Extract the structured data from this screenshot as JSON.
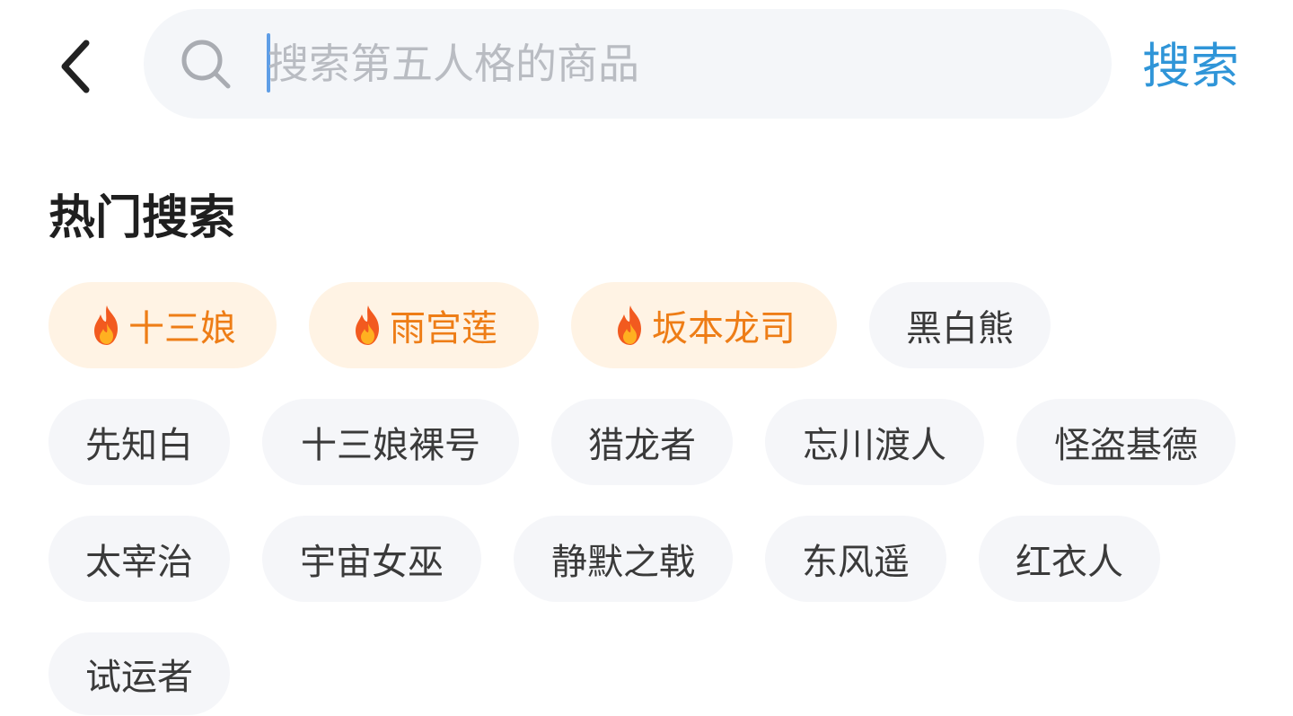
{
  "header": {
    "back_icon": "chevron-left-icon",
    "search_icon": "search-icon",
    "search_placeholder": "搜索第五人格的商品",
    "search_value": "",
    "search_button_label": "搜索",
    "accent_color": "#2f95d8"
  },
  "hot_search": {
    "title": "热门搜索",
    "hot_color": "#ee7d16",
    "hot_bg": "#fff3e4",
    "tags": [
      {
        "label": "十三娘",
        "hot": true,
        "icon": "fire-icon"
      },
      {
        "label": "雨宫莲",
        "hot": true,
        "icon": "fire-icon"
      },
      {
        "label": "坂本龙司",
        "hot": true,
        "icon": "fire-icon"
      },
      {
        "label": "黑白熊",
        "hot": false
      },
      {
        "label": "先知白",
        "hot": false
      },
      {
        "label": "十三娘裸号",
        "hot": false
      },
      {
        "label": "猎龙者",
        "hot": false
      },
      {
        "label": "忘川渡人",
        "hot": false
      },
      {
        "label": "怪盗基德",
        "hot": false
      },
      {
        "label": "太宰治",
        "hot": false
      },
      {
        "label": "宇宙女巫",
        "hot": false
      },
      {
        "label": "静默之戟",
        "hot": false
      },
      {
        "label": "东风遥",
        "hot": false
      },
      {
        "label": "红衣人",
        "hot": false
      },
      {
        "label": "试运者",
        "hot": false
      }
    ]
  }
}
